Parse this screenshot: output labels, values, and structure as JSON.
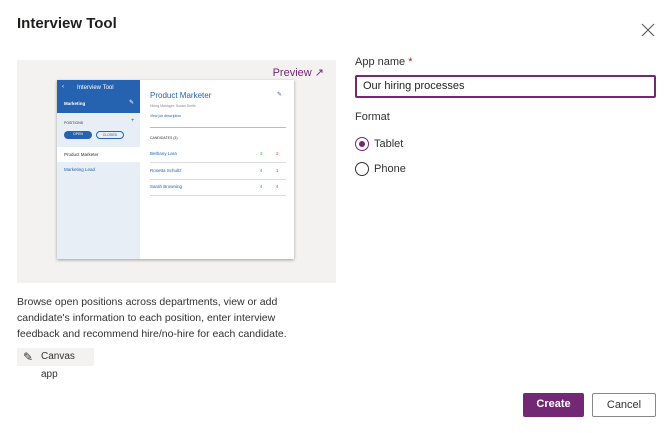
{
  "dialog": {
    "title": "Interview Tool",
    "close_icon": "close-icon"
  },
  "preview": {
    "link_label": "Preview",
    "app": {
      "header_title": "Interview Tool",
      "department": "Marketing",
      "positions_label": "POSITIONS",
      "open_label": "OPEN",
      "closed_label": "CLOSED",
      "positions": [
        "Product Marketer",
        "Marketing Lead"
      ],
      "job_title": "Product Marketer",
      "hiring_manager": "Hiring Manager: Susan Smith",
      "view_job": "View job description",
      "candidates_label": "CANDIDATES (3)",
      "candidates": [
        {
          "name": "Bethany Lara",
          "up": "3",
          "down": "2"
        },
        {
          "name": "Rosetta Schultz",
          "up": "4",
          "down": "1"
        },
        {
          "name": "Sarah Browning",
          "up": "4",
          "down": "4"
        }
      ]
    }
  },
  "description": "Browse open positions across departments, view or add candidate's information to each position, enter interview feedback and recommend hire/no-hire for each candidate.",
  "tag": "Canvas app",
  "form": {
    "app_name_label": "App name",
    "required_mark": "*",
    "app_name_value": "Our hiring processes",
    "format_label": "Format",
    "options": [
      {
        "label": "Tablet",
        "selected": true
      },
      {
        "label": "Phone",
        "selected": false
      }
    ]
  },
  "buttons": {
    "create": "Create",
    "cancel": "Cancel"
  },
  "colors": {
    "accent": "#742774",
    "app_blue": "#2563b0"
  }
}
